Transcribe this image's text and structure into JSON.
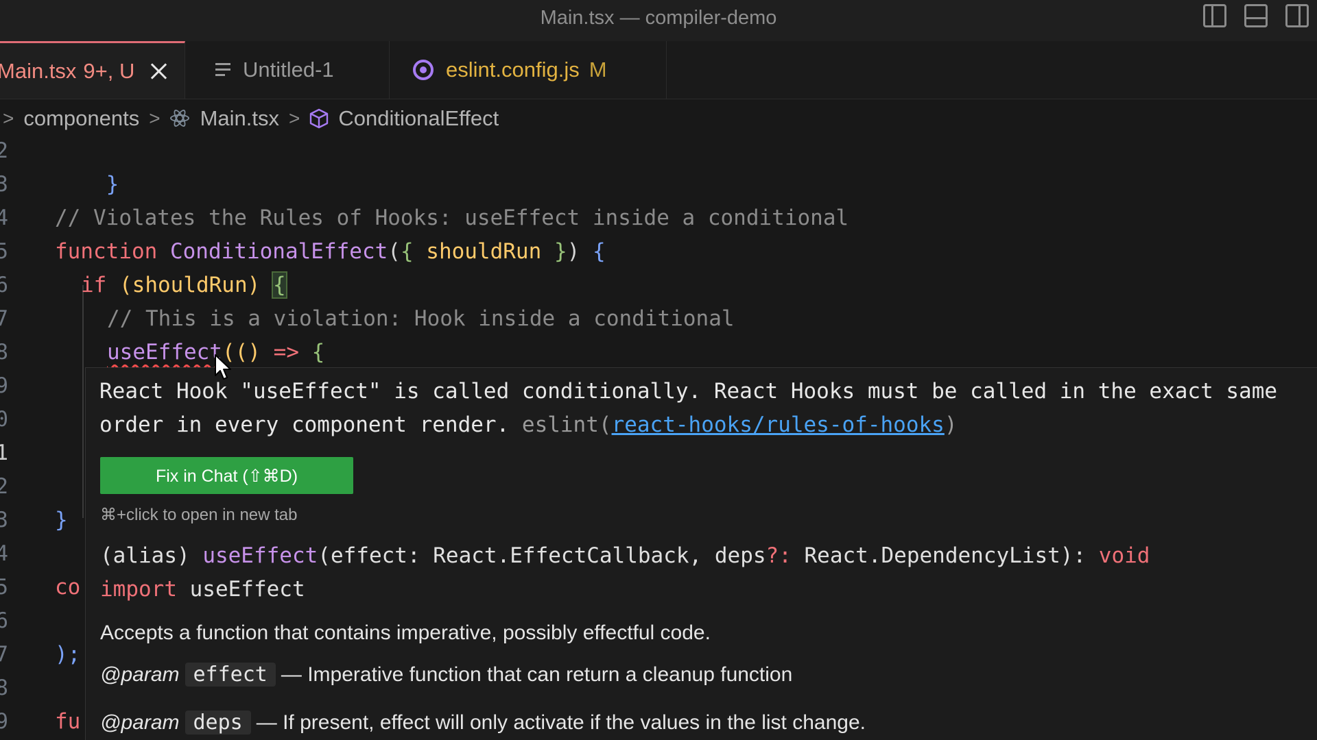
{
  "window": {
    "title": "Main.tsx — compiler-demo"
  },
  "layout_icons": [
    "toggle-primary-sidebar-icon",
    "toggle-panel-icon",
    "toggle-secondary-sidebar-icon"
  ],
  "tabs": [
    {
      "label": "Main.tsx",
      "status": "9+, U",
      "active": true,
      "icon": "close-icon"
    },
    {
      "label": "Untitled-1",
      "status": "",
      "active": false,
      "icon": "text-file-icon"
    },
    {
      "label": "eslint.config.js",
      "status": "M",
      "active": false,
      "icon": "eslint-icon"
    }
  ],
  "breadcrumb": {
    "items": [
      "components",
      "Main.tsx",
      "ConditionalEffect"
    ]
  },
  "editor": {
    "line_numbers": [
      "2",
      "3",
      "4",
      "5",
      "6",
      "7",
      "8",
      "9",
      "0",
      "1",
      "2",
      "3",
      "4",
      "5",
      "6",
      "7",
      "8",
      "9"
    ],
    "current_line_index": 9,
    "lines": {
      "l2": "}",
      "l4": "// Violates the Rules of Hooks: useEffect inside a conditional",
      "l5_kw": "function",
      "l5_name": "ConditionalEffect",
      "l5_open": "(",
      "l5_brace_open": "{",
      "l5_param": "shouldRun",
      "l5_brace_close": "}",
      "l5_close": ")",
      "l5_body": "{",
      "l6_kw": "if",
      "l6_cond": "(shouldRun)",
      "l6_brace": "{",
      "l7": "// This is a violation: Hook inside a conditional",
      "l8_fn": "useEffect",
      "l8_rest_a": "(()",
      "l8_arrow": "=>",
      "l8_brace": "{",
      "l13": "}",
      "l15_partial": "co",
      "l17": ");",
      "l19_partial": "fu"
    }
  },
  "hover": {
    "message_line1": "React Hook \"useEffect\" is called conditionally. React Hooks must be called in the exact same",
    "message_line2_pre": "order in every component render.",
    "eslint_prefix": "eslint(",
    "rule_link": "react-hooks/rules-of-hooks",
    "eslint_suffix": ")",
    "fix_button": "Fix in Chat (⇧⌘D)",
    "hint": "⌘+click to open in new tab",
    "sig_alias": "(alias) ",
    "sig_fn": "useEffect",
    "sig_params_a": "(effect: React.EffectCallback, deps",
    "sig_opt": "?:",
    "sig_params_b": " React.DependencyList): ",
    "sig_ret": "void",
    "import_kw": "import",
    "import_name": " useEffect",
    "description": "Accepts a function that contains imperative, possibly effectful code.",
    "params": [
      {
        "tag": "@param",
        "name": "effect",
        "text": "— Imperative function that can return a cleanup function"
      },
      {
        "tag": "@param",
        "name": "deps",
        "text": "— If present, effect will only activate if the values in the list change."
      }
    ]
  },
  "colors": {
    "background": "#181818",
    "error_squiggle": "#f14c4c",
    "fix_button": "#2ea043",
    "link": "#4aa3f5",
    "active_tab_text": "#f28b82"
  }
}
